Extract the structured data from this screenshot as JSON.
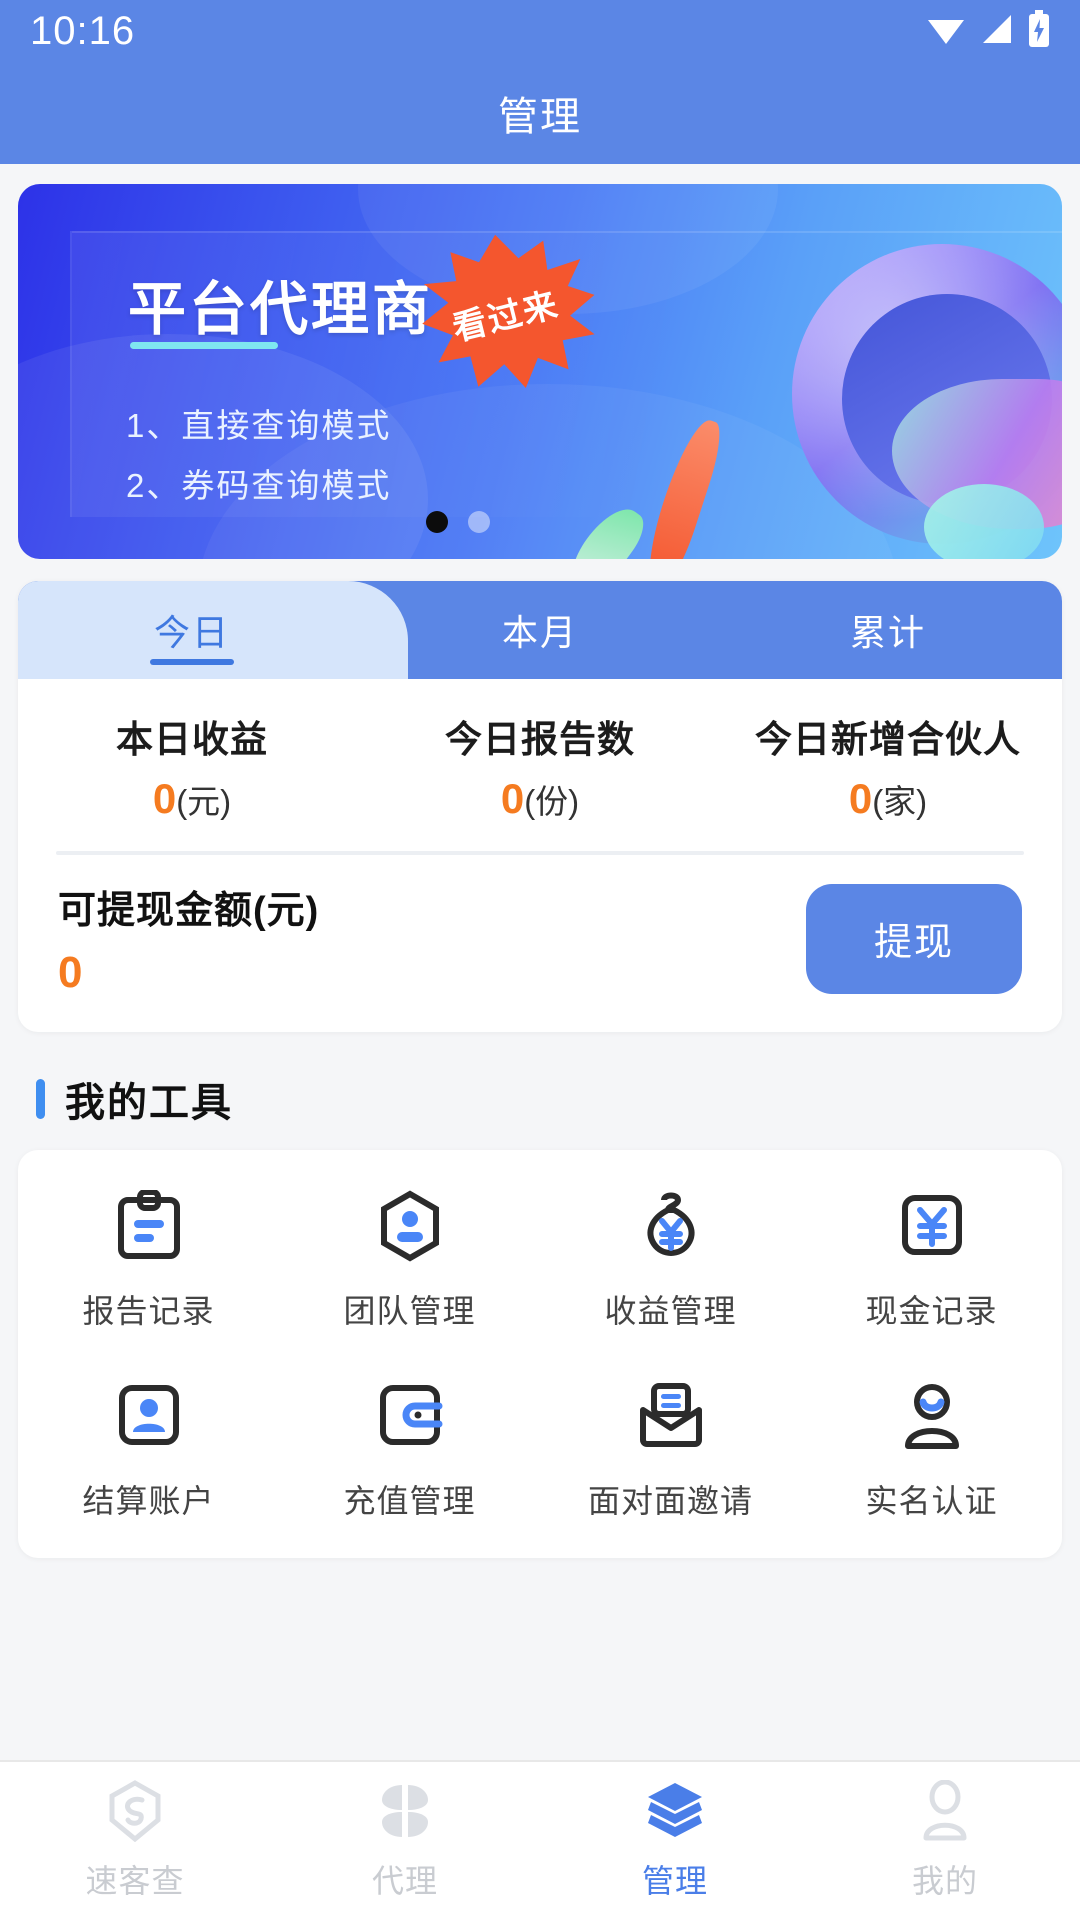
{
  "status_bar": {
    "time": "10:16",
    "icons": [
      "wifi-icon",
      "cellular-signal-icon",
      "battery-charging-icon"
    ]
  },
  "header": {
    "title": "管理"
  },
  "banner": {
    "title": "平台代理商",
    "badge": "看过来",
    "items": [
      "1、直接查询模式",
      "2、券码查询模式"
    ],
    "pagination": {
      "count": 2,
      "active_index": 0
    }
  },
  "stats_card": {
    "tabs": [
      {
        "label": "今日",
        "active": true
      },
      {
        "label": "本月",
        "active": false
      },
      {
        "label": "累计",
        "active": false
      }
    ],
    "stats": [
      {
        "label": "本日收益",
        "value": "0",
        "unit": "(元)"
      },
      {
        "label": "今日报告数",
        "value": "0",
        "unit": "(份)"
      },
      {
        "label": "今日新增合伙人",
        "value": "0",
        "unit": "(家)"
      }
    ],
    "cash": {
      "label": "可提现金额(元)",
      "value": "0",
      "button": "提现"
    }
  },
  "tools_section": {
    "title": "我的工具",
    "tools": [
      {
        "label": "报告记录",
        "icon": "clipboard-icon"
      },
      {
        "label": "团队管理",
        "icon": "hexagon-person-icon"
      },
      {
        "label": "收益管理",
        "icon": "money-bag-yuan-icon"
      },
      {
        "label": "现金记录",
        "icon": "square-yuan-icon"
      },
      {
        "label": "结算账户",
        "icon": "square-person-icon"
      },
      {
        "label": "充值管理",
        "icon": "wallet-icon"
      },
      {
        "label": "面对面邀请",
        "icon": "envelope-icon"
      },
      {
        "label": "实名认证",
        "icon": "person-verified-icon"
      }
    ]
  },
  "bottom_nav": {
    "items": [
      {
        "label": "速客查",
        "icon": "hexagon-logo-icon",
        "active": false
      },
      {
        "label": "代理",
        "icon": "clover-grid-icon",
        "active": false
      },
      {
        "label": "管理",
        "icon": "layers-icon",
        "active": true
      },
      {
        "label": "我的",
        "icon": "profile-person-icon",
        "active": false
      }
    ]
  },
  "colors": {
    "primary": "#5b86e5",
    "accent_orange": "#f57b20",
    "nav_active": "#4a7ee8",
    "banner_badge": "#f4562e",
    "icon_blue": "#4a86f7",
    "tab_active_bg": "#d6e5fb"
  }
}
